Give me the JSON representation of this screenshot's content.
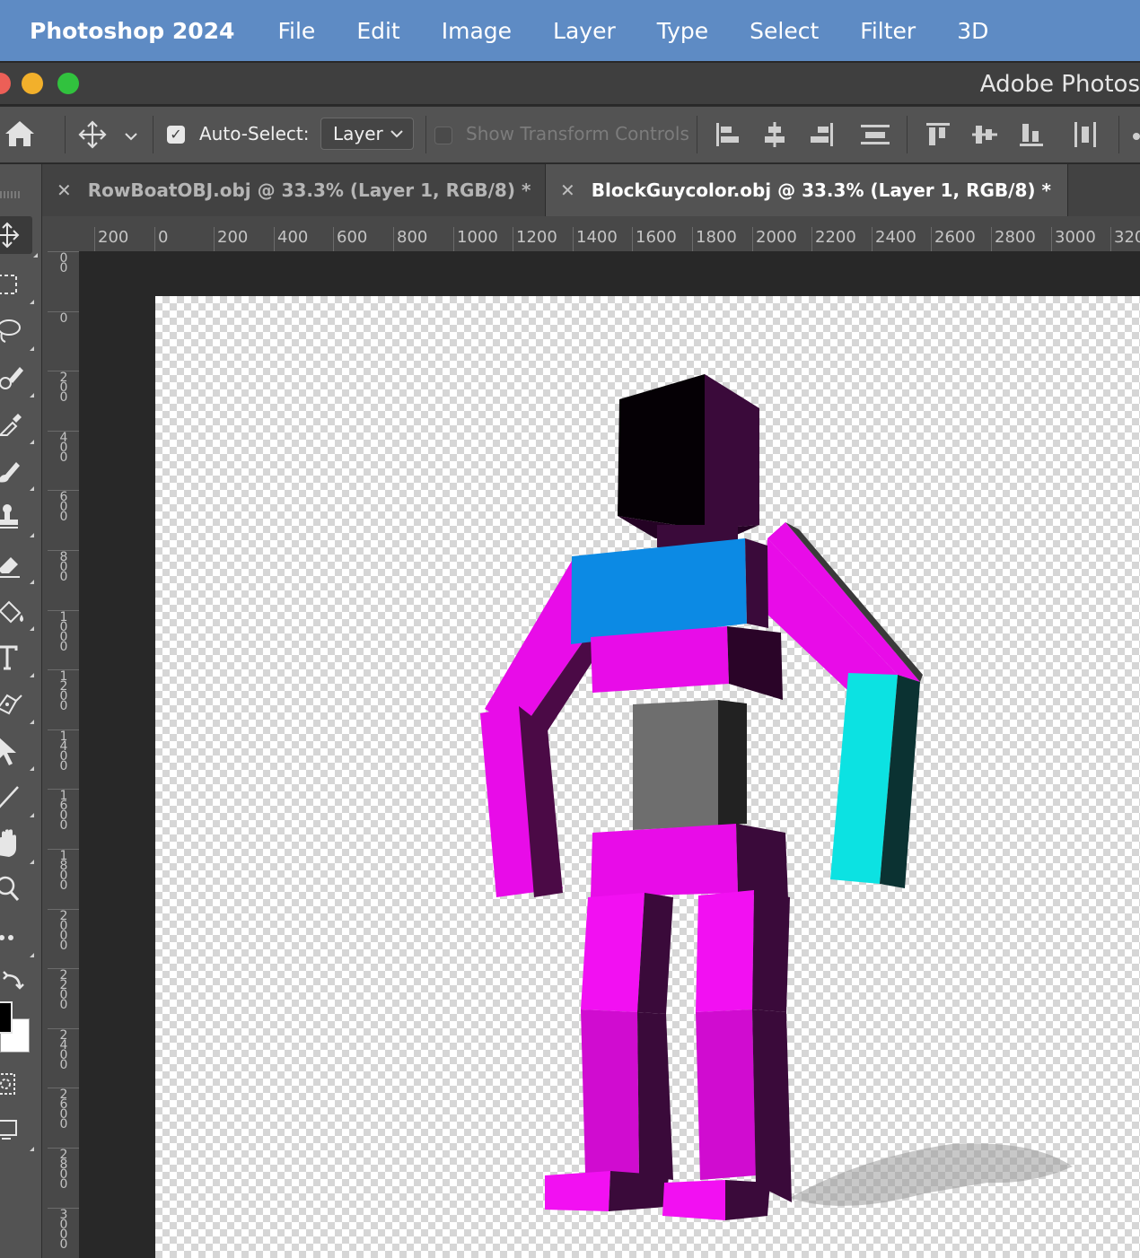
{
  "menubar": {
    "app_name": "Photoshop 2024",
    "items": [
      "File",
      "Edit",
      "Image",
      "Layer",
      "Type",
      "Select",
      "Filter",
      "3D"
    ]
  },
  "window": {
    "title": "Adobe Photos"
  },
  "options_bar": {
    "auto_select_label": "Auto-Select:",
    "auto_select_checked": true,
    "auto_select_value": "Layer",
    "show_transform_label": "Show Transform Controls",
    "show_transform_checked": false
  },
  "tabs": [
    {
      "label": "RowBoatOBJ.obj @ 33.3% (Layer 1, RGB/8) *",
      "active": false
    },
    {
      "label": "BlockGuycolor.obj @ 33.3% (Layer 1, RGB/8) *",
      "active": true
    }
  ],
  "ruler": {
    "horizontal_labels": [
      "200",
      "0",
      "200",
      "400",
      "600",
      "800",
      "1000",
      "1200",
      "1400",
      "1600",
      "1800",
      "2000",
      "2200",
      "2400",
      "2600",
      "2800",
      "3000",
      "320"
    ],
    "vertical_labels": [
      "00",
      "0",
      "200",
      "400",
      "600",
      "800",
      "1000",
      "1200",
      "1400",
      "1600",
      "1800",
      "2000",
      "2200",
      "2400",
      "2600",
      "2800",
      "3000"
    ]
  },
  "tools": [
    "move-tool-icon",
    "marquee-tool-icon",
    "lasso-tool-icon",
    "quick-selection-tool-icon",
    "eyedropper-tool-icon",
    "brush-tool-icon",
    "clone-stamp-tool-icon",
    "eraser-tool-icon",
    "paint-bucket-tool-icon",
    "type-tool-icon",
    "pen-tool-icon",
    "path-selection-tool-icon",
    "line-tool-icon",
    "hand-tool-icon",
    "zoom-tool-icon",
    "more-tools-icon",
    "swap-colors-icon",
    "quick-mask-icon",
    "screen-mode-icon"
  ],
  "colors": {
    "menubar": "#5e8bc4",
    "ui_panel": "#535353",
    "foreground_swatch": "#000000",
    "background_swatch": "#ffffff",
    "figure_magenta": "#e80ce8",
    "figure_blue": "#0c8ae4",
    "figure_cyan": "#0ce2e2",
    "figure_grey": "#6e6e6e"
  }
}
